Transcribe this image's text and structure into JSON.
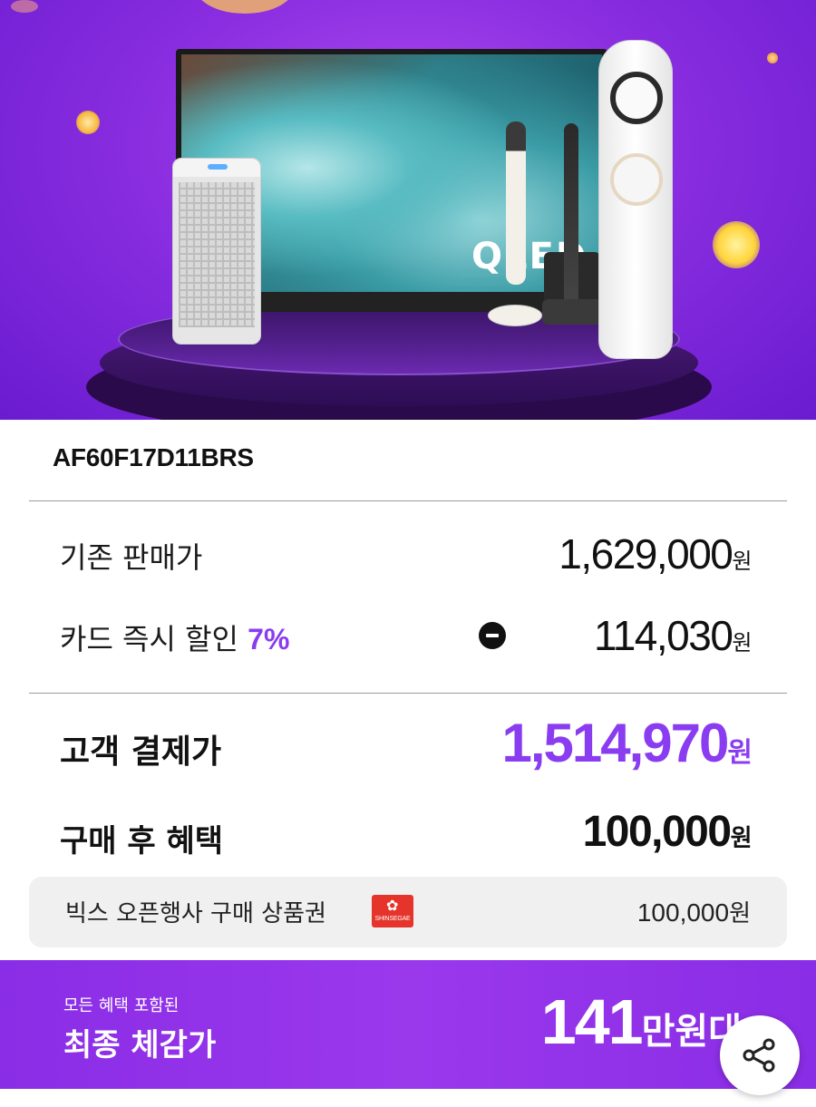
{
  "product": {
    "model": "AF60F17D11BRS",
    "hero": {
      "tv_logo": "QLED"
    }
  },
  "pricing": {
    "original_label": "기존 판매가",
    "original_value": "1,629,000",
    "card_discount_label": "카드 즉시 할인 ",
    "card_discount_percent": "7%",
    "card_discount_value": "114,030",
    "final_label": "고객 결제가",
    "final_value": "1,514,970",
    "after_label": "구매 후 혜택",
    "after_value": "100,000",
    "currency": "원"
  },
  "benefit": {
    "label": "빅스 오픈행사 구매 상품권",
    "logo_text": "SHINSEGAE",
    "value": "100,000",
    "currency": "원"
  },
  "banner": {
    "sub": "모든 혜택 포함된",
    "main": "최종 체감가",
    "number": "141",
    "unit": "만원대"
  },
  "icons": {
    "minus": "minus-circle-icon",
    "share": "share-icon"
  },
  "colors": {
    "accent": "#8a3cf0",
    "banner": "#9030e8",
    "ssg": "#e5342b"
  }
}
